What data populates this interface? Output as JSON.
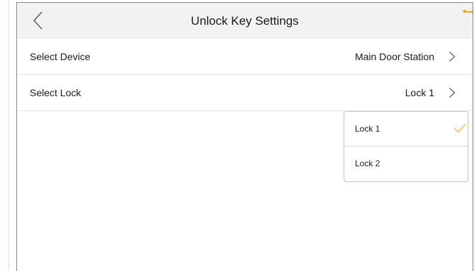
{
  "header": {
    "title": "Unlock Key Settings",
    "back_icon": "chevron-left-icon"
  },
  "rows": [
    {
      "label": "Select Device",
      "value": "Main Door Station",
      "icon": "chevron-right-icon"
    },
    {
      "label": "Select Lock",
      "value": "Lock 1",
      "icon": "chevron-right-icon"
    }
  ],
  "lock_dropdown": {
    "options": [
      {
        "label": "Lock 1",
        "selected": true,
        "icon": "checkmark-icon"
      },
      {
        "label": "Lock 2",
        "selected": false
      }
    ]
  },
  "colors": {
    "accent_check": "#f2b94a",
    "window_border": "#5c8fd6",
    "corner_accent": "#f2a91c",
    "title_bar_bg": "#f2f2f2"
  }
}
